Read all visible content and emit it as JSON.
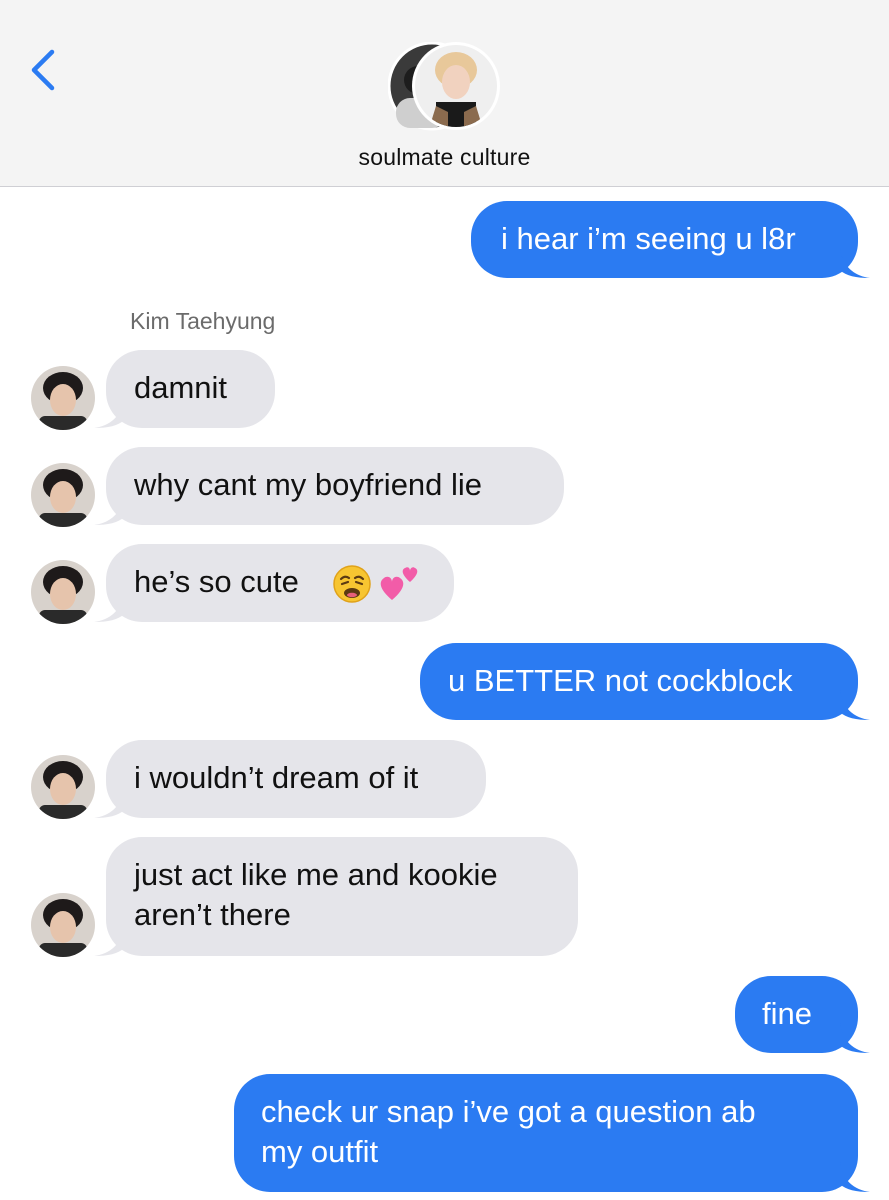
{
  "header": {
    "back_icon": "chevron-left-icon",
    "group_name": "soulmate culture"
  },
  "colors": {
    "sent_bubble": "#2b7bf2",
    "received_bubble": "#e5e5ea",
    "header_bg": "#f4f4f4",
    "accent": "#2b7bf2"
  },
  "sender_label": "Kim Taehyung",
  "messages": [
    {
      "direction": "sent",
      "lines": [
        "i hear i’m seeing u l8r"
      ]
    },
    {
      "direction": "received",
      "lines": [
        "damnit"
      ]
    },
    {
      "direction": "received",
      "lines": [
        "why cant my boyfriend lie"
      ]
    },
    {
      "direction": "received",
      "lines": [
        "he’s so cute"
      ],
      "emoji": [
        "weary-face-emoji",
        "two-hearts-emoji"
      ]
    },
    {
      "direction": "sent",
      "lines": [
        "u BETTER not cockblock"
      ]
    },
    {
      "direction": "received",
      "lines": [
        "i wouldn’t dream of it"
      ]
    },
    {
      "direction": "received",
      "lines": [
        "just act like me and kookie",
        "aren’t there"
      ]
    },
    {
      "direction": "sent",
      "lines": [
        "fine"
      ]
    },
    {
      "direction": "sent",
      "lines": [
        "check ur snap i’ve got a question ab",
        "my outfit"
      ]
    }
  ]
}
